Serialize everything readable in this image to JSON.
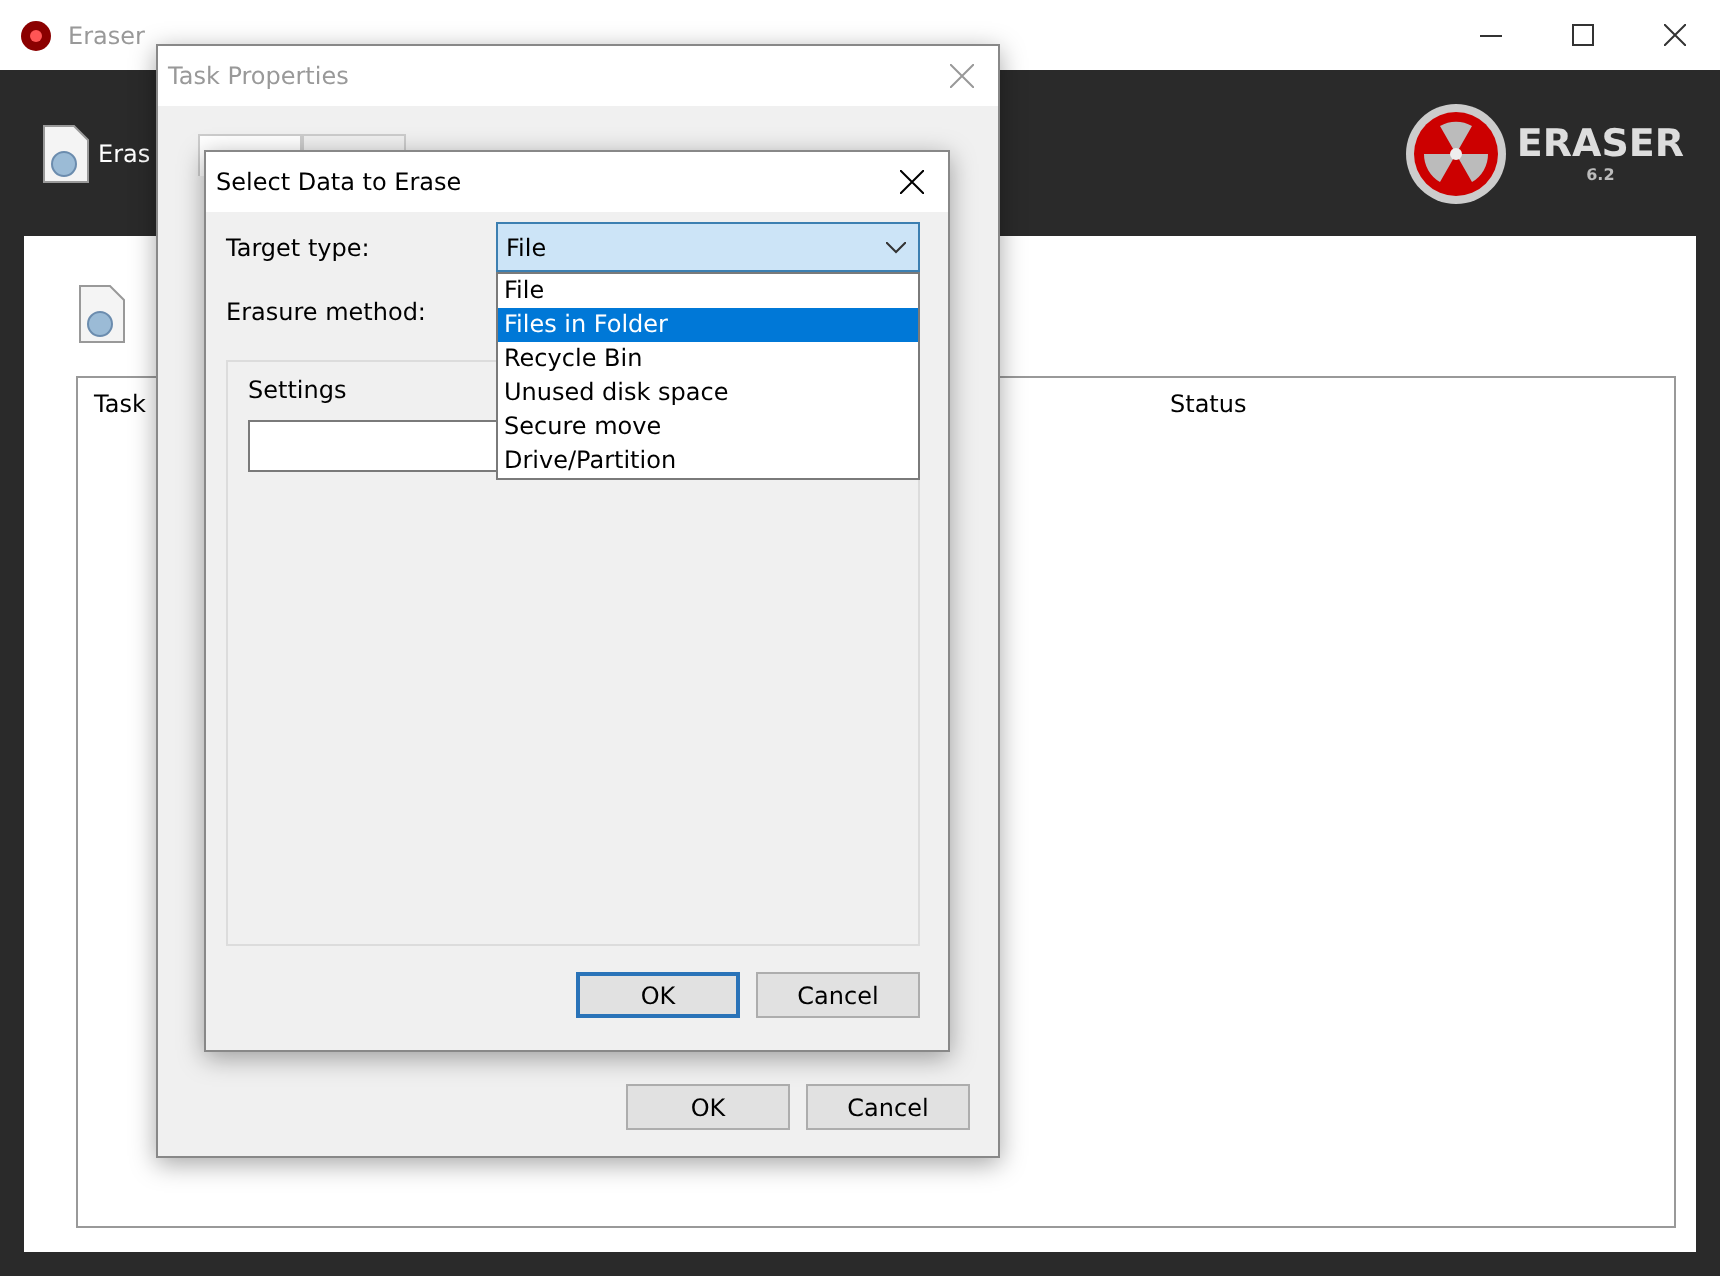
{
  "window": {
    "title": "Eraser"
  },
  "toolbar": {
    "erase_button": "Eras"
  },
  "logo": {
    "name": "ERASER",
    "version": "6.2"
  },
  "table": {
    "columns": [
      "Task",
      "Status"
    ]
  },
  "task_properties": {
    "title": "Task Properties",
    "buttons": [
      "OK",
      "Cancel"
    ]
  },
  "select_data": {
    "title": "Select Data to Erase",
    "target_label": "Target type:",
    "target_value": "File",
    "method_label": "Erasure method:",
    "settings_label": "Settings",
    "options": [
      {
        "label": "File",
        "selected": false
      },
      {
        "label": "Files in Folder",
        "selected": true
      },
      {
        "label": "Recycle Bin",
        "selected": false
      },
      {
        "label": "Unused disk space",
        "selected": false
      },
      {
        "label": "Secure move",
        "selected": false
      },
      {
        "label": "Drive/Partition",
        "selected": false
      }
    ],
    "buttons": [
      {
        "label": "OK",
        "default": true
      },
      {
        "label": "Cancel",
        "default": false
      }
    ]
  }
}
